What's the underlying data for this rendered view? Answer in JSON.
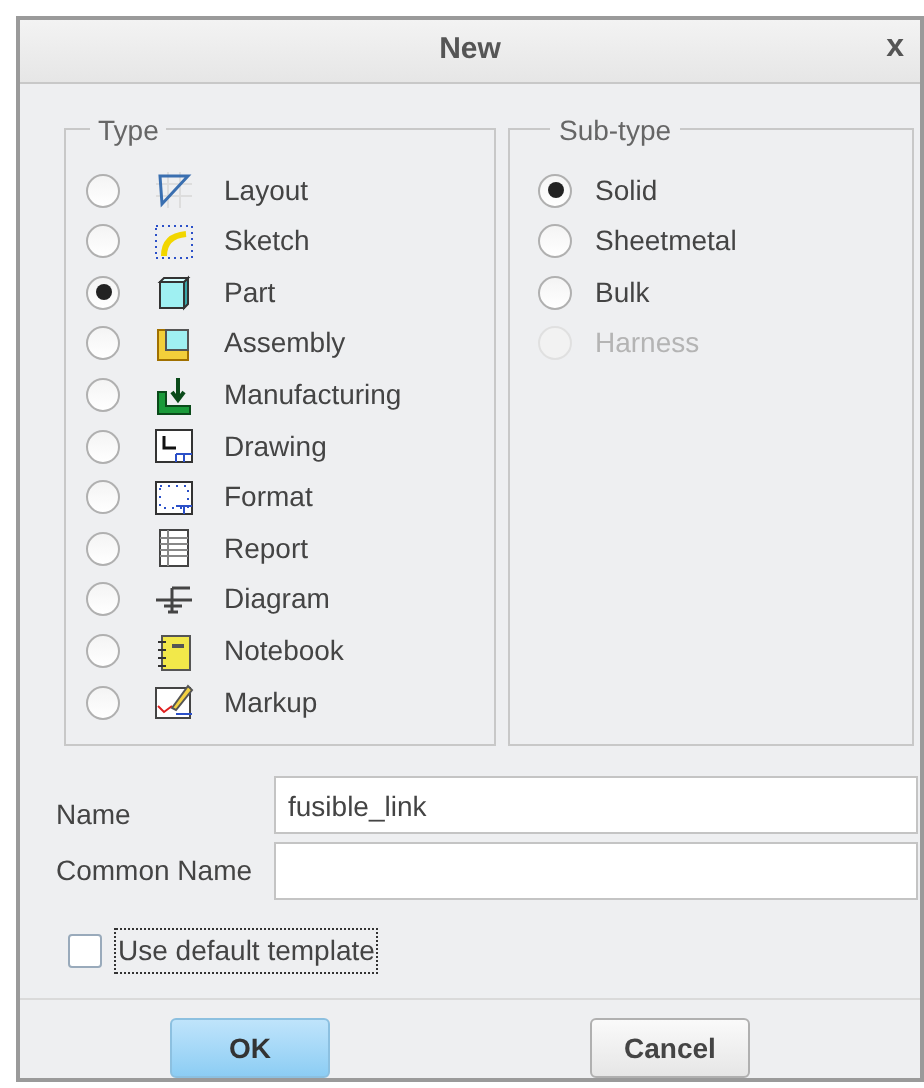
{
  "window": {
    "title": "New",
    "close": "x"
  },
  "type_group": {
    "title": "Type",
    "items": [
      {
        "label": "Layout",
        "selected": false
      },
      {
        "label": "Sketch",
        "selected": false
      },
      {
        "label": "Part",
        "selected": true
      },
      {
        "label": "Assembly",
        "selected": false
      },
      {
        "label": "Manufacturing",
        "selected": false
      },
      {
        "label": "Drawing",
        "selected": false
      },
      {
        "label": "Format",
        "selected": false
      },
      {
        "label": "Report",
        "selected": false
      },
      {
        "label": "Diagram",
        "selected": false
      },
      {
        "label": "Notebook",
        "selected": false
      },
      {
        "label": "Markup",
        "selected": false
      }
    ]
  },
  "subtype_group": {
    "title": "Sub-type",
    "items": [
      {
        "label": "Solid",
        "selected": true,
        "disabled": false
      },
      {
        "label": "Sheetmetal",
        "selected": false,
        "disabled": false
      },
      {
        "label": "Bulk",
        "selected": false,
        "disabled": false
      },
      {
        "label": "Harness",
        "selected": false,
        "disabled": true
      }
    ]
  },
  "fields": [
    {
      "label": "Name",
      "value": "fusible_link"
    },
    {
      "label": "Common Name"
    }
  ],
  "template_checkbox": {
    "label": "Use default template",
    "checked": false,
    "focused": true
  },
  "buttons": [
    {
      "label": "OK",
      "default": true
    },
    {
      "label": "Cancel",
      "default": false
    }
  ]
}
